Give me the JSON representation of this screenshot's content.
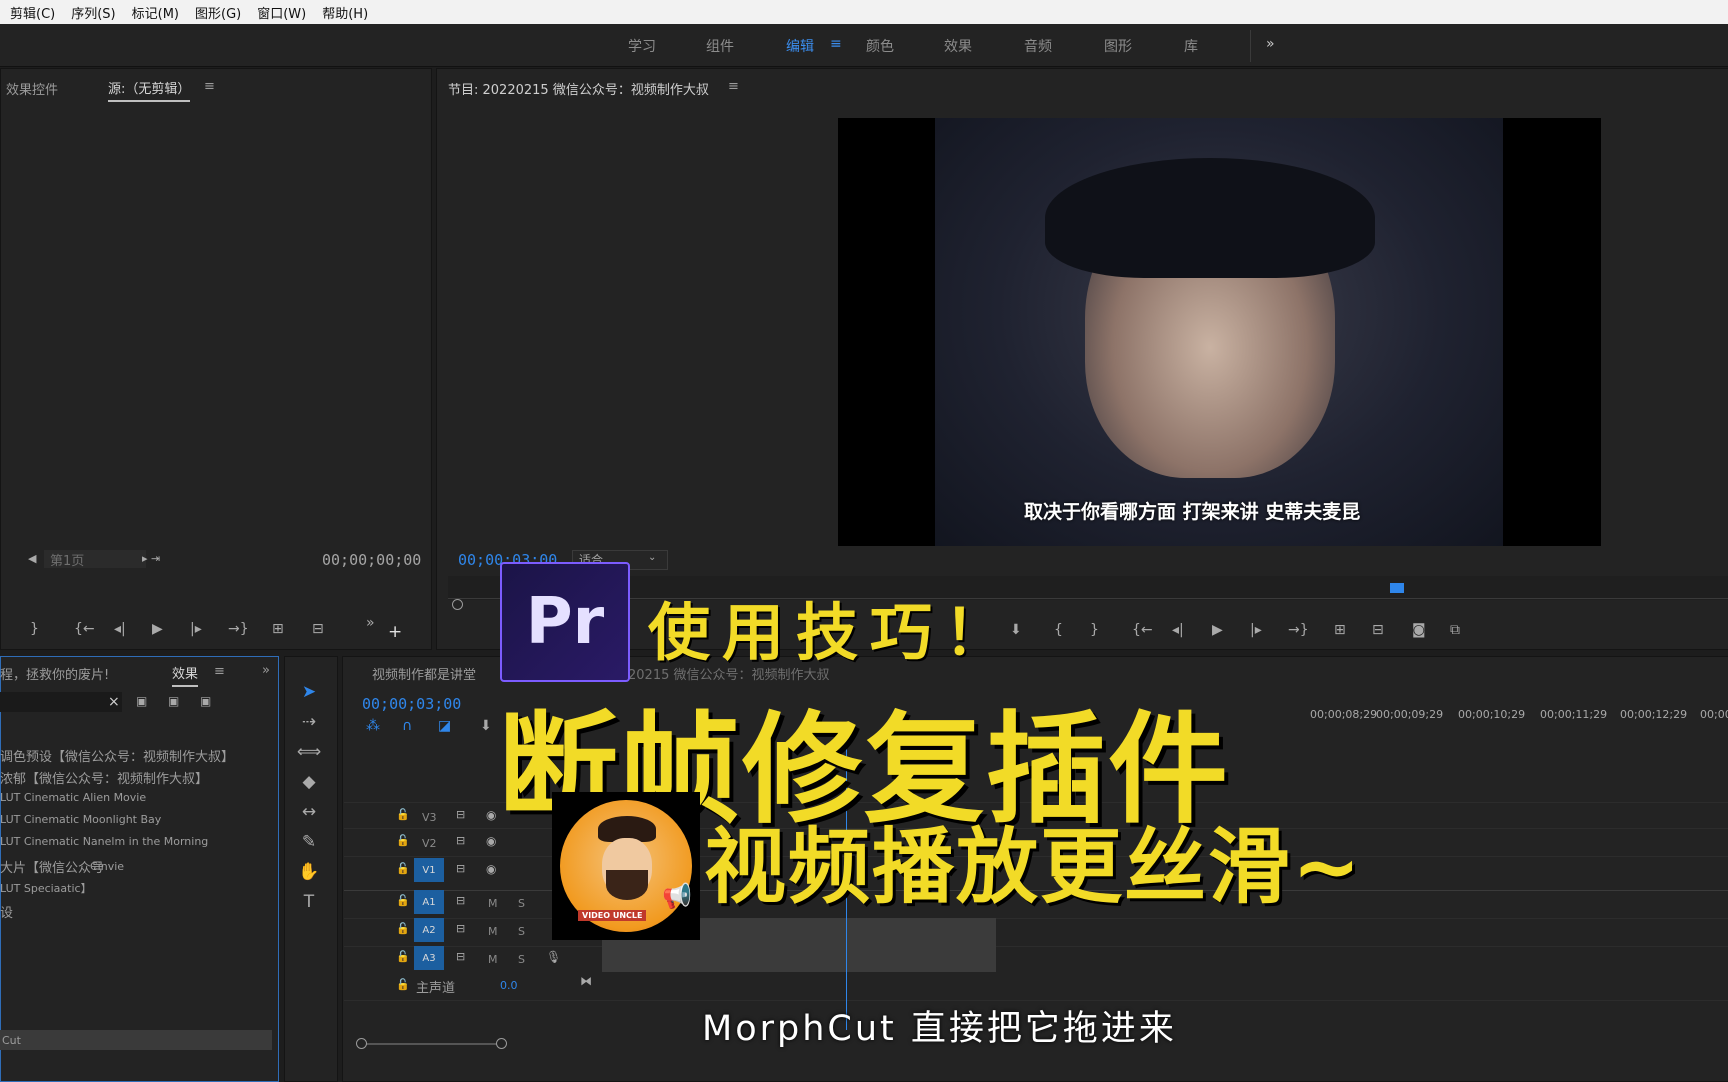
{
  "menu": [
    "剪辑(C)",
    "序列(S)",
    "标记(M)",
    "图形(G)",
    "窗口(W)",
    "帮助(H)"
  ],
  "workspaces": [
    "学习",
    "组件",
    "编辑",
    "颜色",
    "效果",
    "音频",
    "图形",
    "库"
  ],
  "active_workspace": "编辑",
  "source_panel": {
    "tab_effect_controls": "效果控件",
    "tab_source": "源:（无剪辑）",
    "page_label": "第1页",
    "timecode": "00;00;00;00"
  },
  "program_panel": {
    "title": "节目: 20220215 微信公众号：视频制作大叔",
    "timecode": "00;00;03;00",
    "fit": "适合",
    "subtitle": "取决于你看哪方面 打架来讲 史蒂夫麦昆"
  },
  "effects_panel": {
    "tab_left": "程，拯救你的废片!",
    "tab_effects": "效果",
    "items": [
      "调色预设【微信公众号：视频制作大叔】",
      "浓郁【微信公众号：视频制作大叔】",
      "LUT Cinematic Alien Movie",
      "LUT Cinematic Moonlight Bay",
      "LUT Cinematic Nanelm in the Morning",
      "大片【微信公众号",
      "LUT Speciaatic】",
      "设"
    ],
    "bottom_item": "Cut",
    "extra_label": "Cinvie"
  },
  "timeline": {
    "tab_left": "视频制作都是讲堂",
    "tab_sequence": "20215 微信公众号：视频制作大叔",
    "timecode": "00;00;03;00",
    "ruler": [
      "00;00;08;29",
      "00;00;09;29",
      "00;00;10;29",
      "00;00;11;29",
      "00;00;12;29",
      "00;00"
    ],
    "tracks": [
      "V3",
      "V2",
      "V1",
      "A1",
      "A2",
      "A3"
    ],
    "master_label": "主声道",
    "master_value": "0.0",
    "track_letters": [
      "M",
      "S"
    ]
  },
  "overlay": {
    "logo": "Pr",
    "line1": "使用技巧！",
    "line2": "断帧修复插件",
    "line3": "视频播放更丝滑~",
    "caption": "MorphCut 直接把它拖进来",
    "avatar_text": "VIDEO UNCLE"
  },
  "colors": {
    "accent_blue": "#2f86ea",
    "title_yellow": "#f2db27",
    "track_blue": "#1c5fa0"
  }
}
